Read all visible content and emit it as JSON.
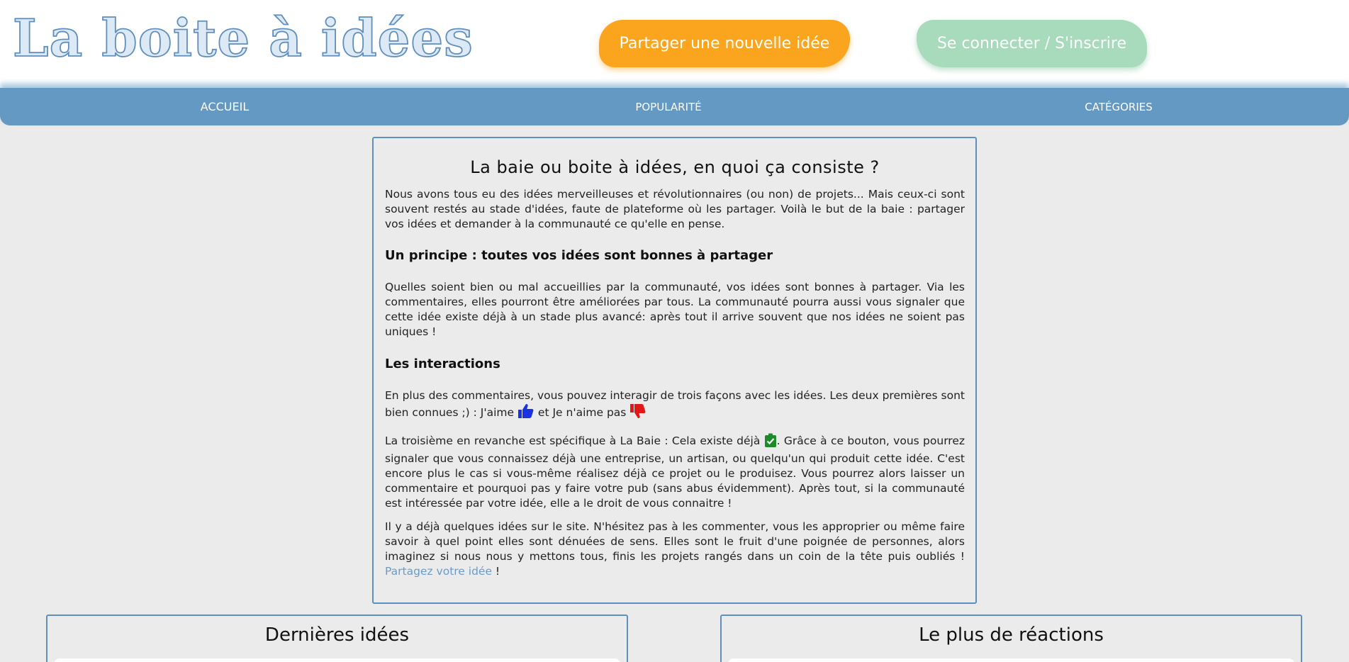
{
  "header": {
    "logo": "La boite à idées",
    "share_button": "Partager une nouvelle idée",
    "login_button": "Se connecter / S'inscrire"
  },
  "nav": {
    "items": [
      "ACCUEIL",
      "POPULARITÉ",
      "CATÉGORIES"
    ]
  },
  "intro": {
    "title": "La baie ou boite à idées, en quoi ça consiste ?",
    "p1": "Nous avons tous eu des idées merveilleuses et révolutionnaires (ou non) de projets... Mais ceux-ci sont souvent restés au stade d'idées, faute de plateforme où les partager. Voilà le but de la baie : partager vos idées et demander à la communauté ce qu'elle en pense.",
    "h_principle": "Un principe : toutes vos idées sont bonnes à partager",
    "p2": "Quelles soient bien ou mal accueillies par la communauté, vos idées sont bonnes à partager. Via les commentaires, elles pourront être améliorées par tous. La communauté pourra aussi vous signaler que cette idée existe déjà à un stade plus avancé: après tout il arrive souvent que nos idées ne soient pas uniques !",
    "h_interactions": "Les interactions",
    "p3_a": "En plus des commentaires, vous pouvez interagir de trois façons avec les idées. Les deux premières sont bien connues ;) : J'aime ",
    "p3_b": " et Je n'aime pas ",
    "p4_a": "La troisième en revanche est spécifique à La Baie : Cela existe déjà ",
    "p4_b": ". Grâce à ce bouton, vous pourrez signaler que vous connaissez déjà une entreprise, un artisan, ou quelqu'un qui produit cette idée. C'est encore plus le cas si vous-même réalisez déjà ce projet ou le produisez. Vous pourrez alors laisser un commentaire et pourquoi pas y faire votre pub (sans abus évidemment). Après tout, si la communauté est intéressée par votre idée, elle a le droit de vous connaitre !",
    "p5_a": "Il y a déjà quelques idées sur le site. N'hésitez pas à les commenter, vous les approprier ou même faire savoir à quel point elles sont dénuées de sens. Elles sont le fruit d'une poignée de personnes, alors imaginez si nous nous y mettons tous, finis les projets rangés dans un coin de la tête puis oubliés !",
    "p5_link": "Partagez votre idée",
    "p5_b": " !"
  },
  "panels": {
    "latest_title": "Dernières idées",
    "reactions_title": "Le plus de réactions"
  },
  "colors": {
    "accent_blue": "#6399c3",
    "share_orange": "#fba51f",
    "login_green": "#a7dbbb",
    "like_blue": "#1a33e0",
    "dislike_red": "#e01818",
    "exists_green": "#1f8a2a"
  },
  "icons": {
    "like": "thumbs-up-icon",
    "dislike": "thumbs-down-icon",
    "exists": "clipboard-check-icon"
  }
}
